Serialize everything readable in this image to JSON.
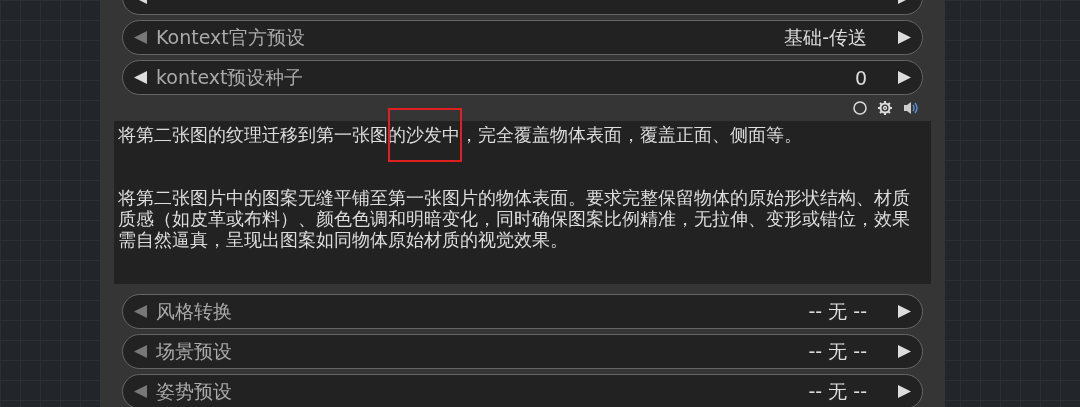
{
  "edge_row": {
    "left_enabled": true
  },
  "preset_rows_top": [
    {
      "label": "Kontext官方预设",
      "value": "基础-传送",
      "left_enabled": false
    },
    {
      "label": "kontext预设种子",
      "value": "0",
      "left_enabled": true
    }
  ],
  "prompt": {
    "paragraphs": [
      "将第二张图的纹理迁移到第一张图的沙发中，完全覆盖物体表面，覆盖正面、侧面等。",
      "将第二张图片中的图案无缝平铺至第一张图片的物体表面。要求完整保留物体的原始形状结构、材质质感（如皮革或布料）、颜色色调和明暗变化，同时确保图案比例精准，无拉伸、变形或错位，效果需自然逼真，呈现出图案如同物体原始材质的视觉效果。"
    ],
    "annotation": {
      "kind": "red-box"
    }
  },
  "preset_rows_bottom": [
    {
      "label": "风格转换",
      "value": "-- 无 --",
      "left_enabled": false
    },
    {
      "label": "场景预设",
      "value": "-- 无 --",
      "left_enabled": false
    },
    {
      "label": "姿势预设",
      "value": "-- 无 --",
      "left_enabled": false
    }
  ]
}
